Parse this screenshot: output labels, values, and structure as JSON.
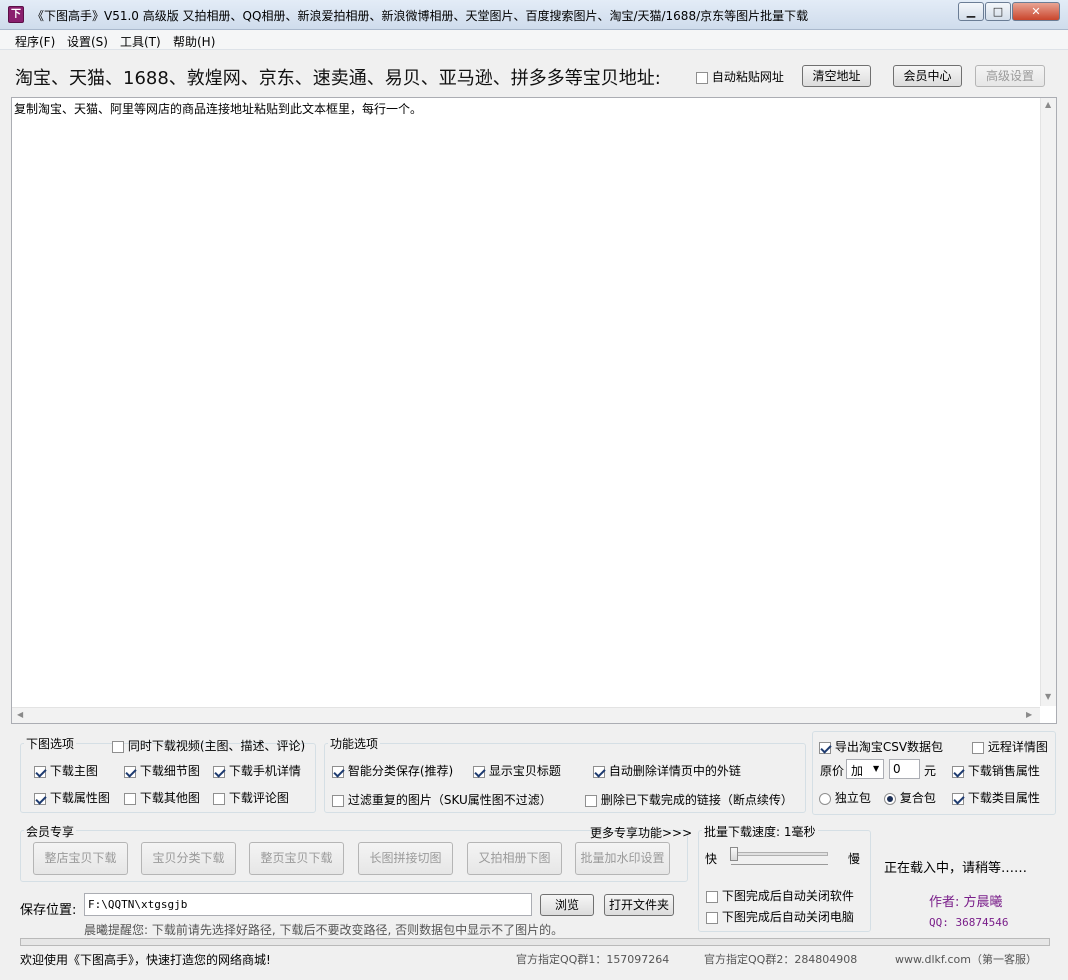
{
  "window": {
    "icon_char": "下",
    "title": "《下图高手》V51.0  高级版   又拍相册、QQ相册、新浪爱拍相册、新浪微博相册、天堂图片、百度搜索图片、淘宝/天猫/1688/京东等图片批量下载",
    "min_label": "▁",
    "max_label": "□",
    "close_label": "✕"
  },
  "menu": [
    "程序(F)",
    "设置(S)",
    "工具(T)",
    "帮助(H)"
  ],
  "header": {
    "headline": "淘宝、天猫、1688、敦煌网、京东、速卖通、易贝、亚马逊、拼多多等宝贝地址:",
    "auto_paste_label": "自动粘贴网址",
    "auto_paste_checked": false,
    "clear_button": "清空地址",
    "member_button": "会员中心",
    "advanced_button": "高级设置"
  },
  "textarea": {
    "value": "复制淘宝、天猫、阿里等网店的商品连接地址粘贴到此文本框里，每行一个。"
  },
  "download_options": {
    "title": "下图选项",
    "video_label": "同时下载视频(主图、描述、评论)",
    "video_checked": false,
    "items": [
      {
        "label": "下载主图",
        "checked": true
      },
      {
        "label": "下载细节图",
        "checked": true
      },
      {
        "label": "下载手机详情",
        "checked": true
      },
      {
        "label": "下载属性图",
        "checked": true
      },
      {
        "label": "下载其他图",
        "checked": false
      },
      {
        "label": "下载评论图",
        "checked": false
      }
    ]
  },
  "function_options": {
    "title": "功能选项",
    "items": [
      {
        "label": "智能分类保存(推荐)",
        "checked": true
      },
      {
        "label": "显示宝贝标题",
        "checked": true
      },
      {
        "label": "自动删除详情页中的外链",
        "checked": true
      },
      {
        "label": "过滤重复的图片（SKU属性图不过滤）",
        "checked": false
      },
      {
        "label": "删除已下载完成的链接（断点续传）",
        "checked": false
      }
    ]
  },
  "csv": {
    "export_label": "导出淘宝CSV数据包",
    "export_checked": true,
    "remote_label": "远程详情图",
    "remote_checked": false,
    "price_label": "原价",
    "price_op": "加",
    "price_value": "0",
    "price_unit": "元",
    "sales_label": "下载销售属性",
    "sales_checked": true,
    "radio_single": "独立包",
    "radio_combo": "复合包",
    "combo_selected": true,
    "category_label": "下载类目属性",
    "category_checked": true
  },
  "member": {
    "title": "会员专享",
    "more_link": "更多专享功能>>>",
    "buttons": [
      "整店宝贝下载",
      "宝贝分类下载",
      "整页宝贝下载",
      "长图拼接切图",
      "又拍相册下图",
      "批量加水印设置"
    ]
  },
  "save": {
    "label": "保存位置:",
    "path": "F:\\QQTN\\xtgsgjb",
    "browse": "浏览",
    "open_folder": "打开文件夹",
    "reminder": "晨曦提醒您: 下载前请先选择好路径, 下载后不要改变路径, 否则数据包中显示不了图片的。"
  },
  "speed": {
    "title": "批量下载速度: 1毫秒",
    "fast": "快",
    "slow": "慢",
    "close_app_label": "下图完成后自动关闭软件",
    "close_app_checked": false,
    "shutdown_label": "下图完成后自动关闭电脑",
    "shutdown_checked": false
  },
  "right_info": {
    "loading": "正在载入中，请稍等……",
    "author": "作者: 方晨曦",
    "qq": "QQ: 36874546"
  },
  "status": {
    "welcome": "欢迎使用《下图高手》，快速打造您的网络商城!",
    "group1": "官方指定QQ群1：157097264",
    "group2": "官方指定QQ群2：284804908",
    "site": "www.dlkf.com（第一客服）"
  },
  "colors": {
    "author_purple": "#7a1f8a",
    "frame": "#f0f0f0"
  }
}
